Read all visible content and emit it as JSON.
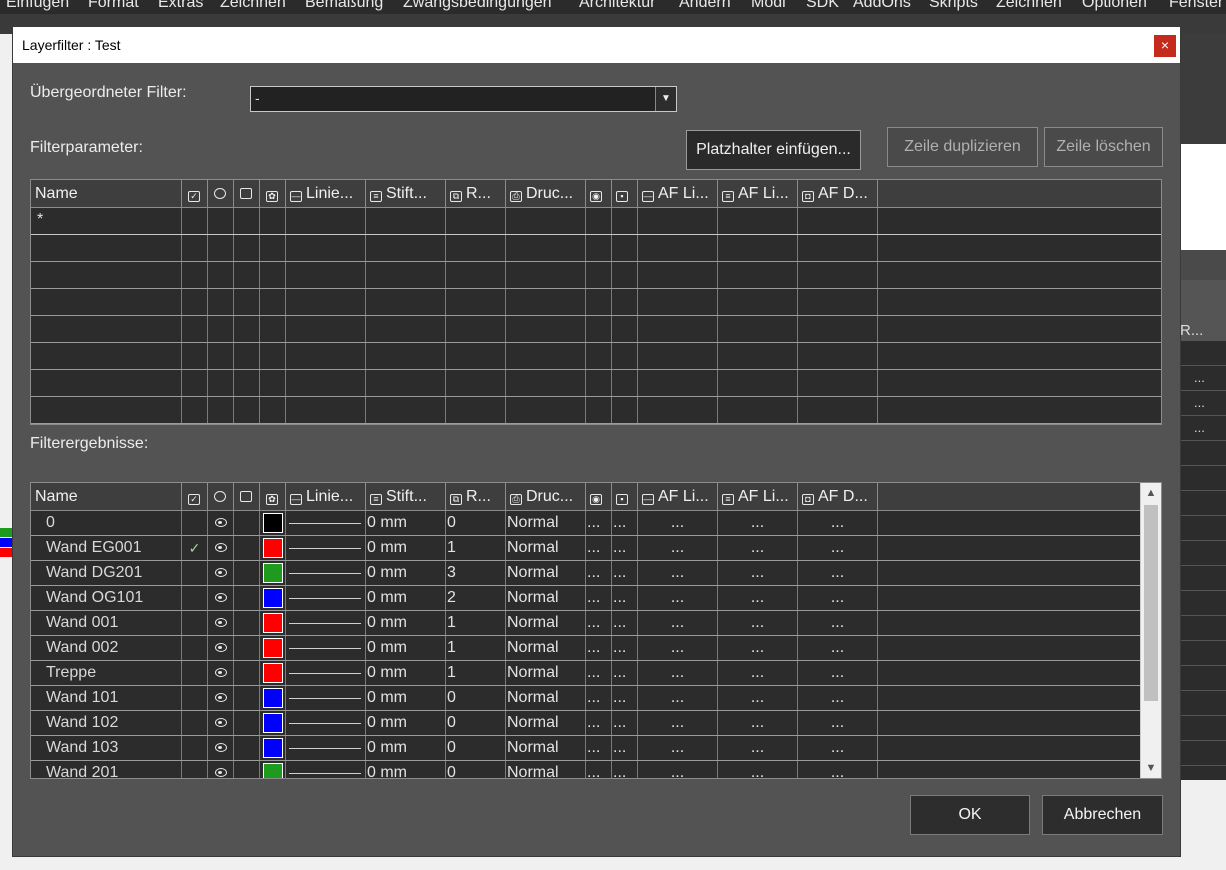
{
  "app_menu": [
    "Einfügen",
    "Format",
    "Extras",
    "Zeichnen",
    "Bemaßung",
    "Zwangsbedingungen",
    "Architektur",
    "Ändern",
    "Modi",
    "SDK",
    "AddOns",
    "Skripts",
    "Zeichnen",
    "Optionen",
    "Fenster"
  ],
  "background": {
    "panel_header_label": "R...",
    "panel_dots": [
      "...",
      "...",
      "..."
    ]
  },
  "dialog": {
    "title": "Layerfilter : Test",
    "close_glyph": "×",
    "parent_filter_label": "Übergeordneter Filter:",
    "parent_filter_value": "-",
    "filter_params_label": "Filterparameter:",
    "insert_placeholder_label": "Platzhalter einfügen...",
    "duplicate_row_label": "Zeile duplizieren",
    "delete_row_label": "Zeile löschen",
    "filter_results_label": "Filterergebnisse:",
    "ok_label": "OK",
    "cancel_label": "Abbrechen"
  },
  "columns": [
    {
      "key": "name",
      "label": "Name",
      "icon": ""
    },
    {
      "key": "on",
      "label": "",
      "icon": "checkmark-icon"
    },
    {
      "key": "visible",
      "label": "",
      "icon": "eye-icon"
    },
    {
      "key": "locked",
      "label": "",
      "icon": "lock-icon"
    },
    {
      "key": "color",
      "label": "",
      "icon": "palette-icon"
    },
    {
      "key": "linetype",
      "label": "Linie...",
      "icon": "linetype-icon"
    },
    {
      "key": "pen",
      "label": "Stift...",
      "icon": "pen-width-icon"
    },
    {
      "key": "r",
      "label": "R...",
      "icon": "copy-icon"
    },
    {
      "key": "print",
      "label": "Druc...",
      "icon": "printer-icon"
    },
    {
      "key": "c1",
      "label": "",
      "icon": "view-icon"
    },
    {
      "key": "c2",
      "label": "",
      "icon": "color-grid-icon"
    },
    {
      "key": "af1",
      "label": "AF Li...",
      "icon": "af-line-icon"
    },
    {
      "key": "af2",
      "label": "AF Li...",
      "icon": "af-line2-icon"
    },
    {
      "key": "af3",
      "label": "AF D...",
      "icon": "af-print-icon"
    }
  ],
  "filter_params_rows": [
    {
      "name": "*"
    }
  ],
  "results": [
    {
      "name": "0",
      "on": "",
      "color": "#000000",
      "pen": "0 mm",
      "r": "0",
      "print": "Normal"
    },
    {
      "name": "Wand EG001",
      "on": "✓",
      "color": "#ff0000",
      "pen": "0 mm",
      "r": "1",
      "print": "Normal"
    },
    {
      "name": "Wand DG201",
      "on": "",
      "color": "#1e9a1e",
      "pen": "0 mm",
      "r": "3",
      "print": "Normal"
    },
    {
      "name": "Wand OG101",
      "on": "",
      "color": "#0000ff",
      "pen": "0 mm",
      "r": "2",
      "print": "Normal"
    },
    {
      "name": "Wand 001",
      "on": "",
      "color": "#ff0000",
      "pen": "0 mm",
      "r": "1",
      "print": "Normal"
    },
    {
      "name": "Wand 002",
      "on": "",
      "color": "#ff0000",
      "pen": "0 mm",
      "r": "1",
      "print": "Normal"
    },
    {
      "name": "Treppe",
      "on": "",
      "color": "#ff0000",
      "pen": "0 mm",
      "r": "1",
      "print": "Normal"
    },
    {
      "name": "Wand 101",
      "on": "",
      "color": "#0000ff",
      "pen": "0 mm",
      "r": "0",
      "print": "Normal"
    },
    {
      "name": "Wand 102",
      "on": "",
      "color": "#0000ff",
      "pen": "0 mm",
      "r": "0",
      "print": "Normal"
    },
    {
      "name": "Wand 103",
      "on": "",
      "color": "#0000ff",
      "pen": "0 mm",
      "r": "0",
      "print": "Normal"
    },
    {
      "name": "Wand 201",
      "on": "",
      "color": "#1e9a1e",
      "pen": "0 mm",
      "r": "0",
      "print": "Normal"
    }
  ],
  "ellipsis": "...",
  "scroll_up": "▲",
  "scroll_down": "▼"
}
